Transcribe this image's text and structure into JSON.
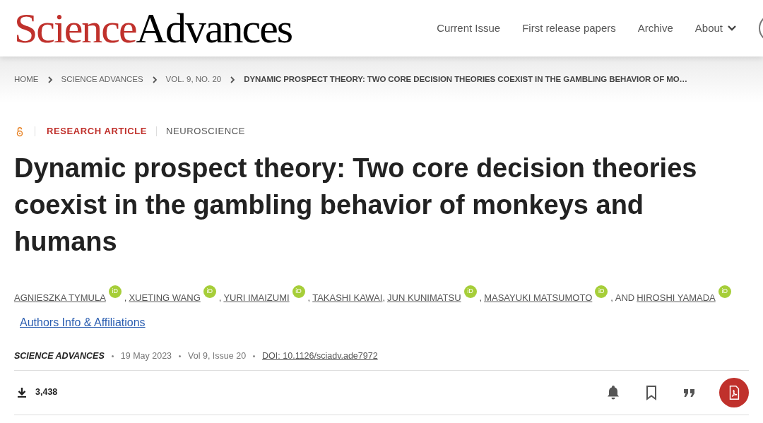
{
  "header": {
    "logo": {
      "first": "Science",
      "second": "Advances"
    },
    "nav": [
      {
        "label": "Current Issue",
        "kind": "link"
      },
      {
        "label": "First release papers",
        "kind": "link"
      },
      {
        "label": "Archive",
        "kind": "link"
      },
      {
        "label": "About",
        "kind": "menu"
      }
    ]
  },
  "breadcrumb": [
    {
      "label": "HOME",
      "current": false
    },
    {
      "label": "SCIENCE ADVANCES",
      "current": false
    },
    {
      "label": "VOL. 9, NO. 20",
      "current": false
    },
    {
      "label": "DYNAMIC PROSPECT THEORY: TWO CORE DECISION THEORIES COEXIST IN THE GAMBLING BEHAVIOR OF MO…",
      "current": true
    }
  ],
  "article": {
    "open_access": true,
    "type": "RESEARCH ARTICLE",
    "subject": "NEUROSCIENCE",
    "title": "Dynamic prospect theory: Two core decision theories coexist in the gambling behavior of monkeys and humans",
    "authors": [
      {
        "name": "AGNIESZKA TYMULA",
        "orcid": "iD",
        "separator": ","
      },
      {
        "name": "XUETING WANG",
        "orcid": "iD",
        "separator": ","
      },
      {
        "name": "YURI IMAIZUMI",
        "orcid": "iD",
        "separator": ","
      },
      {
        "name": "TAKASHI KAWAI",
        "separator": ","
      },
      {
        "name": "JUN KUNIMATSU",
        "orcid": "iD",
        "separator": ","
      },
      {
        "name": "MASAYUKI MATSUMOTO",
        "orcid": "iD",
        "separator": ", AND"
      },
      {
        "name": "HIROSHI YAMADA",
        "orcid": "iD"
      }
    ],
    "affiliations_link": "Authors Info & Affiliations",
    "meta": [
      {
        "kind": "journal",
        "text": "SCIENCE ADVANCES"
      },
      {
        "kind": "plain",
        "text": "19 May 2023"
      },
      {
        "kind": "plain",
        "text": "Vol 9, Issue 20"
      },
      {
        "kind": "link",
        "text": "DOI: 10.1126/sciadv.ade7972"
      }
    ],
    "downloads": "3,438"
  }
}
